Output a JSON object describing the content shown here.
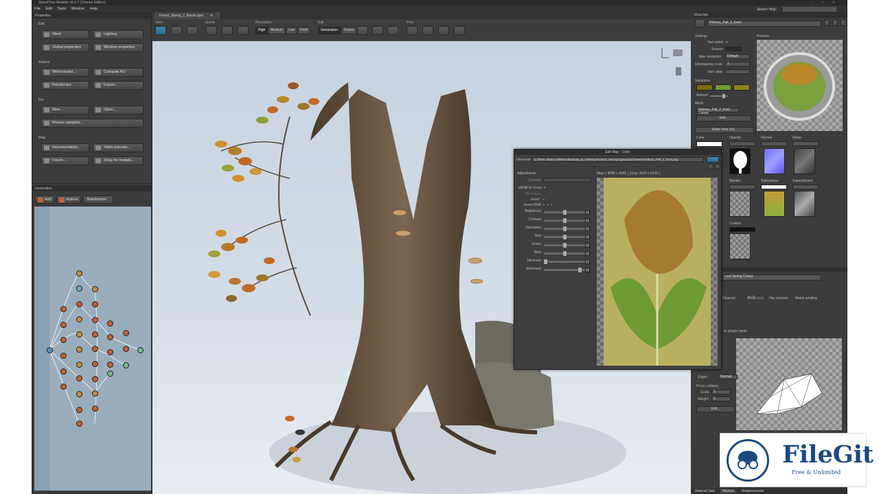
{
  "app": {
    "title": "SpeedTree Modeler v9.0.7 (Cinema Edition)",
    "search_help": "Search Help:"
  },
  "menu": [
    "File",
    "Edit",
    "Tools",
    "Window",
    "Help"
  ],
  "properties": {
    "title": "Properties",
    "sections": [
      {
        "label": "Edit",
        "buttons": [
          "Wind",
          "Lighting",
          "Global properties",
          "Window properties"
        ]
      },
      {
        "label": "Actions",
        "buttons": [
          "Wind wizard...",
          "Compute AO",
          "Randomize",
          "Export..."
        ]
      },
      {
        "label": "File",
        "buttons": [
          "New...",
          "Open...",
          "Browse samples..."
        ]
      },
      {
        "label": "Help",
        "buttons": [
          "Documentation...",
          "Video tutorials...",
          "Forum...",
          "Shop for models..."
        ]
      }
    ]
  },
  "generation": {
    "title": "Generation",
    "buttons": [
      "Add",
      "Actions",
      "Randomize"
    ]
  },
  "document_tab": "Forest_Stump_2_Rocks.spm",
  "toolbar": {
    "groups": [
      "View",
      "Scene",
      "Resolution",
      "Edit",
      "Post"
    ],
    "resolution": [
      "High",
      "Medium",
      "Low",
      "Draft"
    ],
    "edit_modes": [
      "Generators",
      "Nodes"
    ]
  },
  "materials": {
    "title": "Materials",
    "selected": "Hickory_Fall_2_front",
    "settings_label": "Settings",
    "preview_label": "Preview",
    "two_sided": "Two-sided",
    "season": "Season",
    "max_resolution": "Max resolution",
    "max_resolution_value": "Default",
    "unwrapping_scale": "Unwrapping scale",
    "unwrapping_value": "1",
    "user_data": "User data",
    "variations": "Variations",
    "amount": "Amount",
    "mesh": "Mesh",
    "mesh_value": "Hickory_Fall_2_front Cutout",
    "edit": "Edit...",
    "make_new_set": "Make New Set...",
    "maps": [
      {
        "label": "Color"
      },
      {
        "label": "Opacity"
      },
      {
        "label": "Normal"
      },
      {
        "label": "Gloss"
      },
      {
        "label": "Metallic"
      },
      {
        "label": "Subsurface"
      },
      {
        "label": "Subsurface%"
      },
      {
        "label": "Custom"
      }
    ],
    "swatch_colors": [
      "#7a6a14",
      "#6e9a32",
      "#8a8216"
    ]
  },
  "mesh_panel": {
    "dropdown": "Leaf Spring Cutout",
    "channel_label": "Channel",
    "channel_value": "4 / 2",
    "flip_normals": "Flip normals",
    "match_winding": "Match winding",
    "simple_mesh": "to simple mesh",
    "ripple": "Ripple",
    "ripple_value": "Normal",
    "proxy_collision": "Proxy collision",
    "scale": "Scale",
    "scale_value": "1",
    "weight": "Weight",
    "weight_value": "1",
    "edit": "Edit..."
  },
  "bottom_tabs": [
    "Material Sets",
    "Meshes",
    "Displacements"
  ],
  "edit_map": {
    "title": "Edit Map - Color",
    "filename_label": "Filename",
    "filename": "C:/Tree Library v9/Miscellaneous_&_Fantasy/Hickory_DecayingStumps/Leaves/Hickory_Fall_2_front.png",
    "adjustments": "Adjustments",
    "channel": "Channel",
    "srgb": "sRGB to Linear",
    "normalize": "Normalize",
    "invert": "Invert",
    "invert_rgb": "Invert RGB",
    "sliders": [
      "Brightness",
      "Contrast",
      "Saturation",
      "Red",
      "Green",
      "Blue",
      "Minimum",
      "Maximum"
    ],
    "slider_values": [
      0.5,
      0.5,
      0.5,
      0.5,
      0.5,
      0.5,
      0.0,
      0.9
    ],
    "map_info": "Map: ( 4096 x 4096 ) (Orig: 3520 x 6139 )"
  },
  "watermark": {
    "brand": "FileGit",
    "tagline": "Free & Unlimited"
  }
}
